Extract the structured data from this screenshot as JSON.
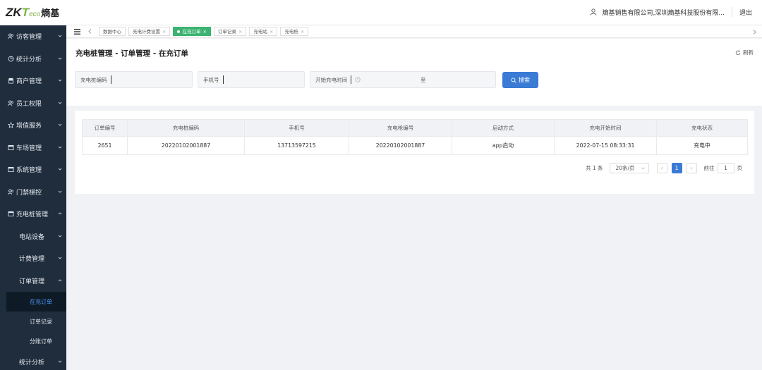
{
  "brand": {
    "zk": "ZK",
    "t": "T",
    "eco": "eco",
    "cn": "熵基"
  },
  "header": {
    "company": "熵基销售有限公司,深圳熵基科技股份有限...",
    "logout": "退出"
  },
  "sidebar": {
    "items": [
      {
        "label": "访客管理"
      },
      {
        "label": "统计分析"
      },
      {
        "label": "商户管理"
      },
      {
        "label": "员工权限"
      },
      {
        "label": "增值服务"
      },
      {
        "label": "车场管理"
      },
      {
        "label": "系统管理"
      },
      {
        "label": "门禁梯控"
      },
      {
        "label": "充电桩管理"
      }
    ],
    "sub": [
      {
        "label": "电站设备"
      },
      {
        "label": "计费管理"
      },
      {
        "label": "订单管理"
      }
    ],
    "sub3": [
      {
        "label": "在充订单"
      },
      {
        "label": "订单记录"
      },
      {
        "label": "分账订单"
      }
    ],
    "bottom": {
      "label": "统计分析"
    }
  },
  "tabs": [
    {
      "label": "数据中心"
    },
    {
      "label": "充电计费设置",
      "x": "×"
    },
    {
      "label": "在充订单",
      "x": "×"
    },
    {
      "label": "订单记录",
      "x": "×"
    },
    {
      "label": "充电站",
      "x": "×"
    },
    {
      "label": "充电桩",
      "x": "×"
    }
  ],
  "page": {
    "title": "充电桩管理 - 订单管理 - 在充订单",
    "refresh": "刷新"
  },
  "filters": {
    "pile_code": "充电桩编码",
    "phone": "手机号",
    "start_time": "开始充电时间",
    "to": "至",
    "search": "搜索"
  },
  "table": {
    "headers": [
      "订单编号",
      "充电桩编码",
      "手机号",
      "充电枪编号",
      "启动方式",
      "充电开始时间",
      "充电状态"
    ],
    "rows": [
      [
        "2651",
        "20220102001887",
        "13713597215",
        "20220102001887",
        "app启动",
        "2022-07-15 08:33:31",
        "充电中"
      ]
    ]
  },
  "pager": {
    "total": "共 1 条",
    "size": "20条/页",
    "prev": "‹",
    "page": "1",
    "next": "›",
    "goto": "前往",
    "goto_value": "1",
    "page_unit": "页"
  }
}
